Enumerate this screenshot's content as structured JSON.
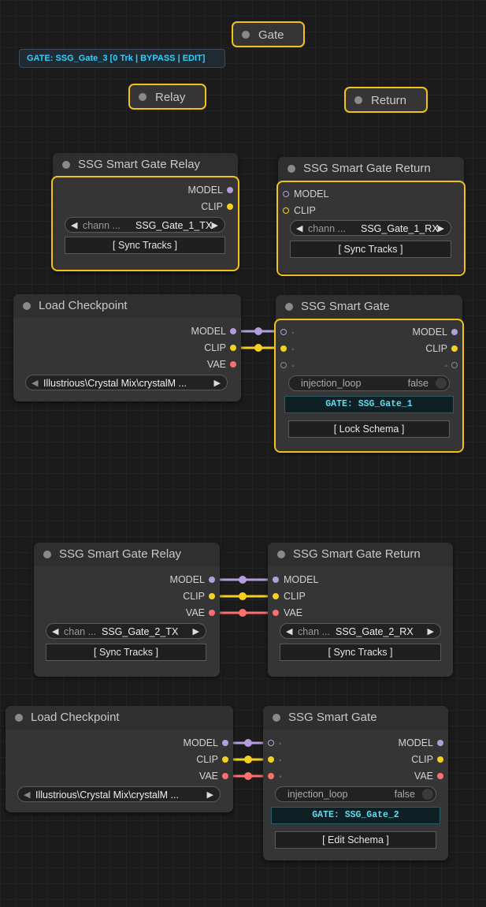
{
  "status_banner": "GATE: SSG_Gate_3 [0 Trk | BYPASS | EDIT]",
  "mini_nodes": {
    "gate": "Gate",
    "relay": "Relay",
    "return": "Return"
  },
  "colors": {
    "model": "#b39ddb",
    "clip": "#f5d020",
    "vae": "#ff6e6e",
    "selection": "#f2c21a",
    "gate_text": "#5fdcf0"
  },
  "relay1": {
    "title": "SSG Smart Gate Relay",
    "out_model": "MODEL",
    "out_clip": "CLIP",
    "combo_label": "chann ...",
    "combo_value": "SSG_Gate_1_TX",
    "button": "[ Sync Tracks ]"
  },
  "return1": {
    "title": "SSG Smart Gate Return",
    "in_model": "MODEL",
    "in_clip": "CLIP",
    "combo_label": "chann ...",
    "combo_value": "SSG_Gate_1_RX",
    "button": "[ Sync Tracks ]"
  },
  "ckpt1": {
    "title": "Load Checkpoint",
    "out_model": "MODEL",
    "out_clip": "CLIP",
    "out_vae": "VAE",
    "combo_value": "Illustrious\\Crystal Mix\\crystalM ..."
  },
  "gate1": {
    "title": "SSG Smart Gate",
    "in_mark": "◦",
    "out_model": "MODEL",
    "out_clip": "CLIP",
    "toggle_label": "injection_loop",
    "toggle_value": "false",
    "gate_label": "GATE: SSG_Gate_1",
    "button": "[ Lock Schema ]"
  },
  "relay2": {
    "title": "SSG Smart Gate Relay",
    "out_model": "MODEL",
    "out_clip": "CLIP",
    "out_vae": "VAE",
    "combo_label": "chan ...",
    "combo_value": "SSG_Gate_2_TX",
    "button": "[ Sync Tracks ]"
  },
  "return2": {
    "title": "SSG Smart Gate Return",
    "in_model": "MODEL",
    "in_clip": "CLIP",
    "in_vae": "VAE",
    "combo_label": "chan ...",
    "combo_value": "SSG_Gate_2_RX",
    "button": "[ Sync Tracks ]"
  },
  "ckpt2": {
    "title": "Load Checkpoint",
    "out_model": "MODEL",
    "out_clip": "CLIP",
    "out_vae": "VAE",
    "combo_value": "Illustrious\\Crystal Mix\\crystalM ..."
  },
  "gate2": {
    "title": "SSG Smart Gate",
    "in_mark": "◦",
    "out_model": "MODEL",
    "out_clip": "CLIP",
    "out_vae": "VAE",
    "toggle_label": "injection_loop",
    "toggle_value": "false",
    "gate_label": "GATE: SSG_Gate_2",
    "button": "[ Edit Schema ]"
  }
}
